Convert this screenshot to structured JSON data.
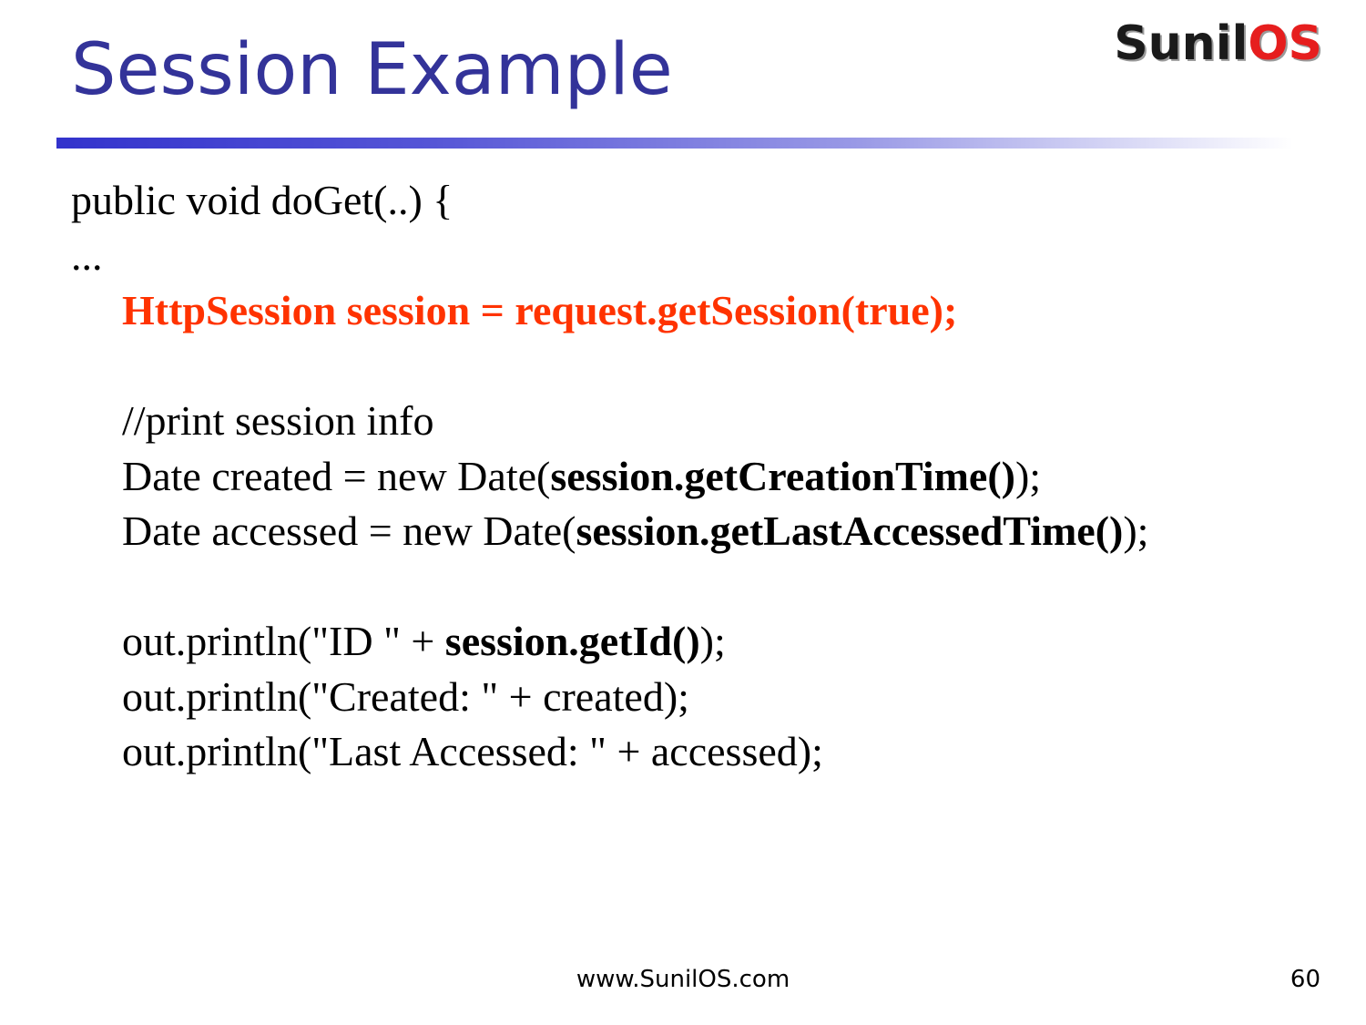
{
  "slide": {
    "title": "Session Example",
    "logo": {
      "part1": "Sunil",
      "part2": "OS"
    },
    "code": {
      "line1": "public void doGet(..) {",
      "line2": "...",
      "line3": "HttpSession session = request.getSession(true);",
      "line5": "//print session info",
      "line6_pre": "Date created = new Date(",
      "line6_bold": "session.getCreationTime()",
      "line6_post": ");",
      "line7_pre": "Date accessed = new Date(",
      "line7_bold": "session.getLastAccessedTime()",
      "line7_post": ");",
      "line9_pre": "out.println(\"ID \" + ",
      "line9_bold": "session.getId()",
      "line9_post": ");",
      "line10": "out.println(\"Created: \" + created);",
      "line11": "out.println(\"Last Accessed: \" + accessed);"
    },
    "footer": {
      "url": "www.SunilOS.com",
      "page_number": "60"
    }
  },
  "colors": {
    "title": "#333399",
    "highlight": "#ff3300",
    "logo_dark": "#1a1a1a",
    "logo_red": "#e61e1e",
    "rule_start": "#3333cc"
  }
}
